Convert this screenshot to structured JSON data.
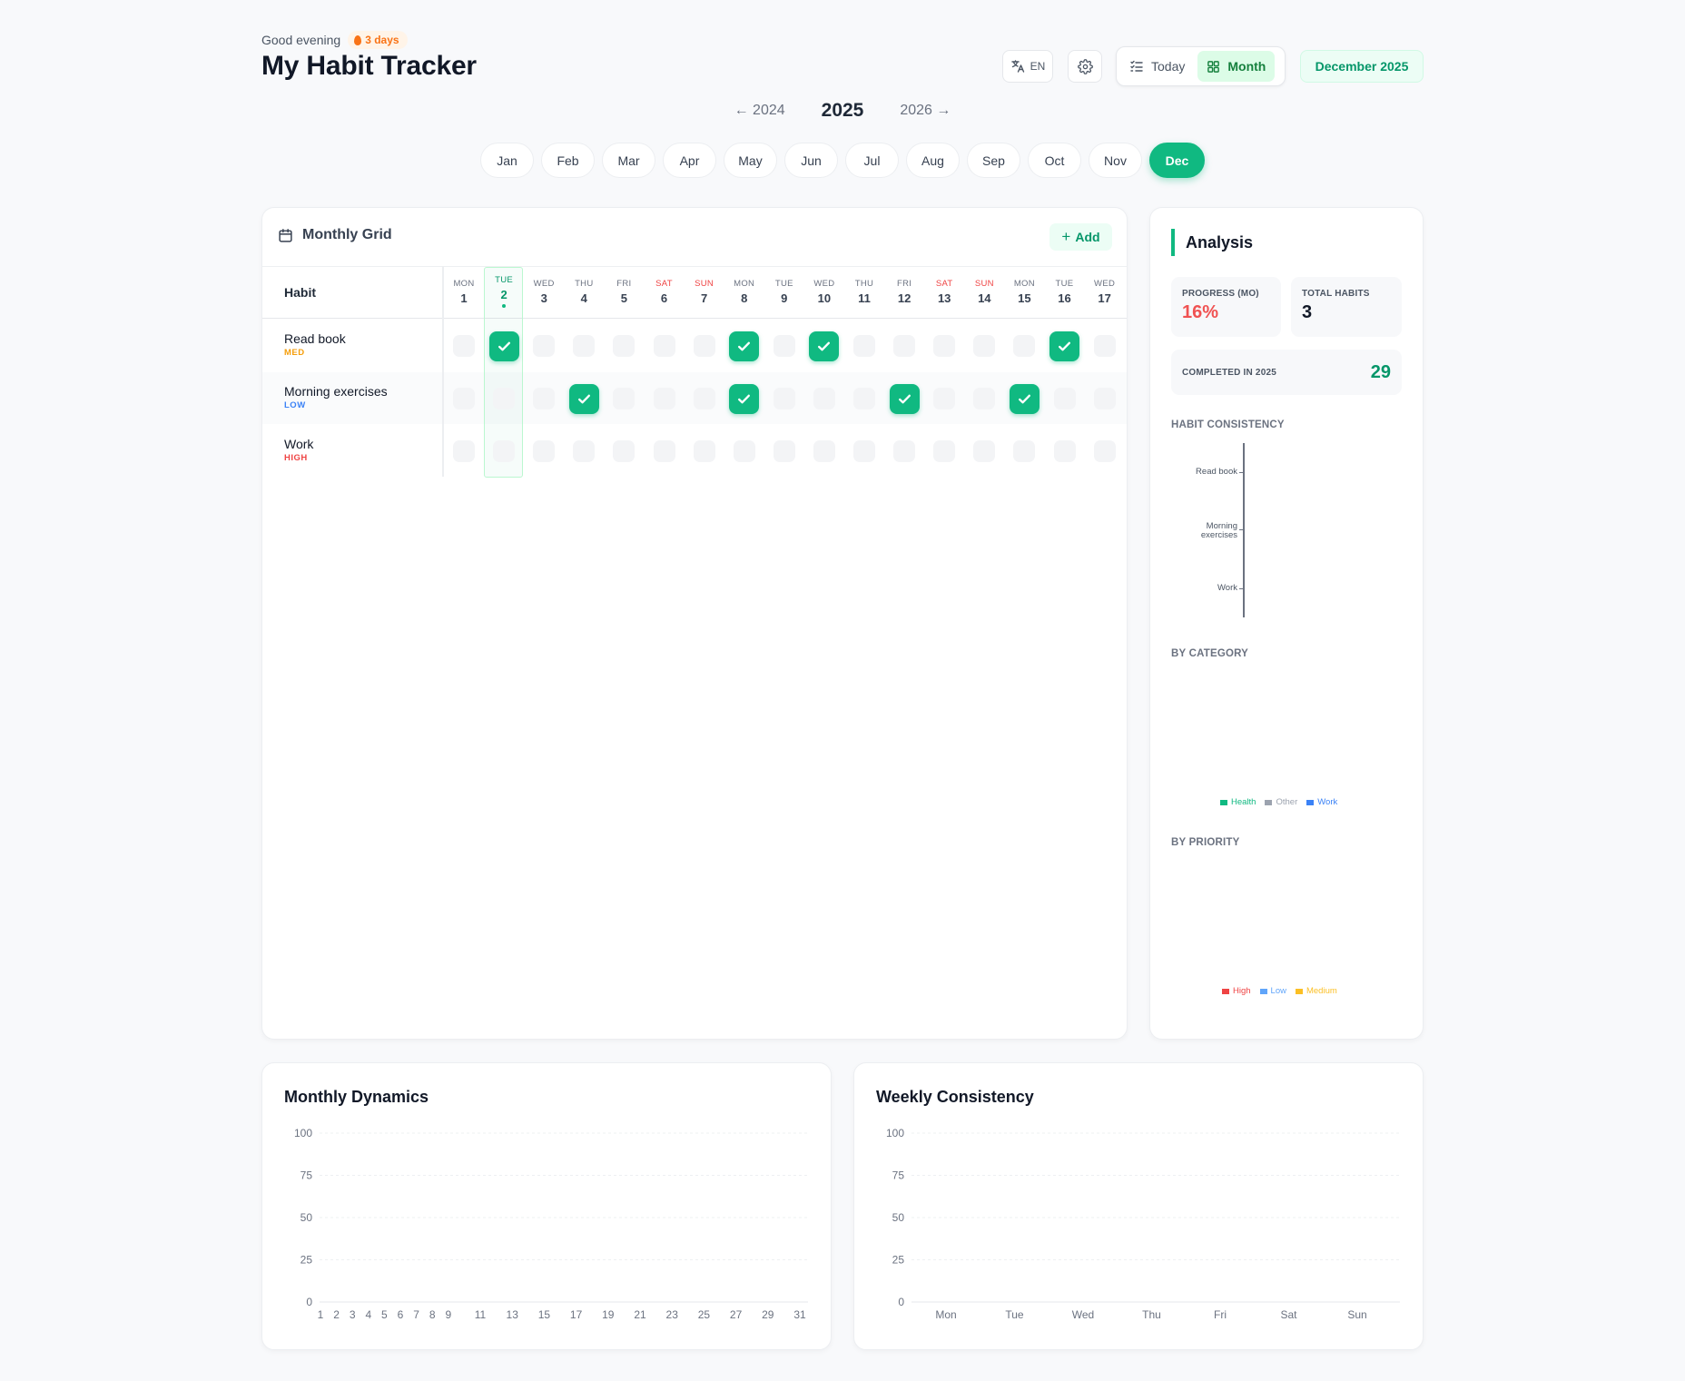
{
  "header": {
    "greeting": "Good evening",
    "streak": "3 days",
    "title": "My Habit Tracker",
    "language": "EN",
    "view_today": "Today",
    "view_month": "Month",
    "current_period": "December 2025"
  },
  "year_nav": {
    "prev": "← 2024",
    "current": "2025",
    "next": "2026 →"
  },
  "months": [
    "Jan",
    "Feb",
    "Mar",
    "Apr",
    "May",
    "Jun",
    "Jul",
    "Aug",
    "Sep",
    "Oct",
    "Nov",
    "Dec"
  ],
  "active_month": "Dec",
  "grid": {
    "title": "Monthly Grid",
    "add_label": "Add",
    "habit_header": "Habit",
    "days": [
      {
        "name": "MON",
        "num": "1"
      },
      {
        "name": "TUE",
        "num": "2"
      },
      {
        "name": "WED",
        "num": "3"
      },
      {
        "name": "THU",
        "num": "4"
      },
      {
        "name": "FRI",
        "num": "5"
      },
      {
        "name": "SAT",
        "num": "6"
      },
      {
        "name": "SUN",
        "num": "7"
      },
      {
        "name": "MON",
        "num": "8"
      },
      {
        "name": "TUE",
        "num": "9"
      },
      {
        "name": "WED",
        "num": "10"
      },
      {
        "name": "THU",
        "num": "11"
      },
      {
        "name": "FRI",
        "num": "12"
      },
      {
        "name": "SAT",
        "num": "13"
      },
      {
        "name": "SUN",
        "num": "14"
      },
      {
        "name": "MON",
        "num": "15"
      },
      {
        "name": "TUE",
        "num": "16"
      },
      {
        "name": "WED",
        "num": "17"
      }
    ],
    "today_day": "2",
    "habits": [
      {
        "name": "Read book",
        "priority": "MED",
        "priority_color": "#f59e0b",
        "done": [
          2,
          8,
          10,
          16
        ]
      },
      {
        "name": "Morning exercises",
        "priority": "LOW",
        "priority_color": "#3b82f6",
        "done": [
          4,
          8,
          12,
          15
        ]
      },
      {
        "name": "Work",
        "priority": "HIGH",
        "priority_color": "#ef4444",
        "done": []
      }
    ]
  },
  "analysis": {
    "title": "Analysis",
    "progress_label": "PROGRESS (MO)",
    "progress_value": "16%",
    "total_label": "TOTAL HABITS",
    "total_value": "3",
    "completed_label": "COMPLETED IN 2025",
    "completed_value": "29",
    "consistency_title": "HABIT CONSISTENCY",
    "consistency_labels": [
      "Read book",
      "Morning exercises",
      "Work"
    ],
    "category_title": "BY CATEGORY",
    "category_legend": [
      {
        "name": "Health",
        "color": "#10b981"
      },
      {
        "name": "Other",
        "color": "#9ca3af"
      },
      {
        "name": "Work",
        "color": "#3b82f6"
      }
    ],
    "priority_title": "BY PRIORITY",
    "priority_legend": [
      {
        "name": "High",
        "color": "#ef4444"
      },
      {
        "name": "Low",
        "color": "#60a5fa"
      },
      {
        "name": "Medium",
        "color": "#fbbf24"
      }
    ]
  },
  "monthly_dynamics": {
    "title": "Monthly Dynamics",
    "chart_data": {
      "type": "line",
      "x": [
        "1",
        "2",
        "3",
        "4",
        "5",
        "6",
        "7",
        "8",
        "9",
        "11",
        "13",
        "15",
        "17",
        "19",
        "21",
        "23",
        "25",
        "27",
        "29",
        "31"
      ],
      "yticks": [
        "0",
        "25",
        "50",
        "75",
        "100"
      ],
      "ylim": [
        0,
        100
      ],
      "series": []
    }
  },
  "weekly_consistency": {
    "title": "Weekly Consistency",
    "chart_data": {
      "type": "bar",
      "categories": [
        "Mon",
        "Tue",
        "Wed",
        "Thu",
        "Fri",
        "Sat",
        "Sun"
      ],
      "yticks": [
        "0",
        "25",
        "50",
        "75",
        "100"
      ],
      "ylim": [
        0,
        100
      ],
      "series": []
    }
  }
}
